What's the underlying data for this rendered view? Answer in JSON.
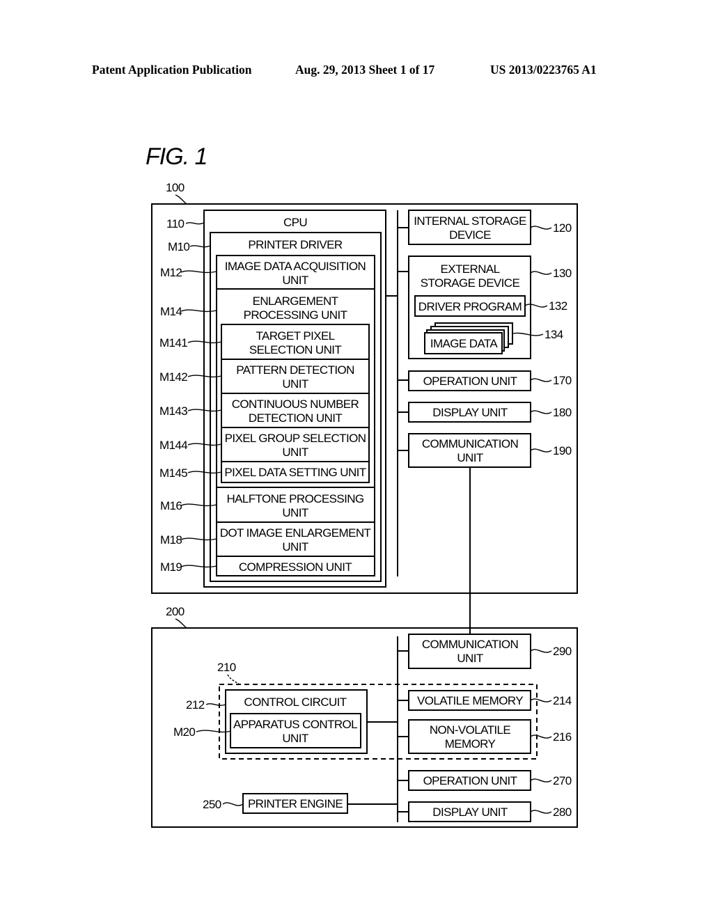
{
  "header": {
    "publication": "Patent Application Publication",
    "date_sheet": "Aug. 29, 2013  Sheet 1 of 17",
    "patent_number": "US 2013/0223765 A1"
  },
  "figure": {
    "title": "FIG. 1"
  },
  "host": {
    "ref": "100",
    "cpu": {
      "ref": "110",
      "label": "CPU"
    },
    "printer_driver": {
      "ref": "M10",
      "label": "PRINTER DRIVER"
    },
    "modules": [
      {
        "ref": "M12",
        "lines": [
          "IMAGE DATA ACQUISITION",
          "UNIT"
        ]
      },
      {
        "ref": "M14",
        "lines": [
          "ENLARGEMENT",
          "PROCESSING UNIT"
        ]
      },
      {
        "ref": "M141",
        "lines": [
          "TARGET PIXEL",
          "SELECTION UNIT"
        ]
      },
      {
        "ref": "M142",
        "lines": [
          "PATTERN DETECTION",
          "UNIT"
        ]
      },
      {
        "ref": "M143",
        "lines": [
          "CONTINUOUS NUMBER",
          "DETECTION UNIT"
        ]
      },
      {
        "ref": "M144",
        "lines": [
          "PIXEL GROUP SELECTION",
          "UNIT"
        ]
      },
      {
        "ref": "M145",
        "lines": [
          "PIXEL DATA SETTING UNIT"
        ]
      },
      {
        "ref": "M16",
        "lines": [
          "HALFTONE PROCESSING",
          "UNIT"
        ]
      },
      {
        "ref": "M18",
        "lines": [
          "DOT IMAGE ENLARGEMENT",
          "UNIT"
        ]
      },
      {
        "ref": "M19",
        "lines": [
          "COMPRESSION UNIT"
        ]
      }
    ],
    "internal_storage": {
      "ref": "120",
      "lines": [
        "INTERNAL STORAGE",
        "DEVICE"
      ]
    },
    "external_storage": {
      "ref": "130",
      "lines": [
        "EXTERNAL",
        "STORAGE DEVICE"
      ]
    },
    "driver_program": {
      "ref": "132",
      "label": "DRIVER PROGRAM"
    },
    "image_data": {
      "ref": "134",
      "label": "IMAGE DATA"
    },
    "operation_unit": {
      "ref": "170",
      "label": "OPERATION UNIT"
    },
    "display_unit": {
      "ref": "180",
      "label": "DISPLAY UNIT"
    },
    "communication_unit": {
      "ref": "190",
      "lines": [
        "COMMUNICATION",
        "UNIT"
      ]
    }
  },
  "printer": {
    "ref": "200",
    "communication_unit": {
      "ref": "290",
      "lines": [
        "COMMUNICATION",
        "UNIT"
      ]
    },
    "controller": {
      "ref": "210"
    },
    "control_circuit": {
      "ref": "212",
      "label": "CONTROL CIRCUIT"
    },
    "apparatus_control_unit": {
      "ref": "M20",
      "lines": [
        "APPARATUS CONTROL",
        "UNIT"
      ]
    },
    "volatile_memory": {
      "ref": "214",
      "label": "VOLATILE MEMORY"
    },
    "non_volatile_memory": {
      "ref": "216",
      "lines": [
        "NON-VOLATILE",
        "MEMORY"
      ]
    },
    "printer_engine": {
      "ref": "250",
      "label": "PRINTER ENGINE"
    },
    "operation_unit": {
      "ref": "270",
      "label": "OPERATION UNIT"
    },
    "display_unit": {
      "ref": "280",
      "label": "DISPLAY UNIT"
    }
  }
}
